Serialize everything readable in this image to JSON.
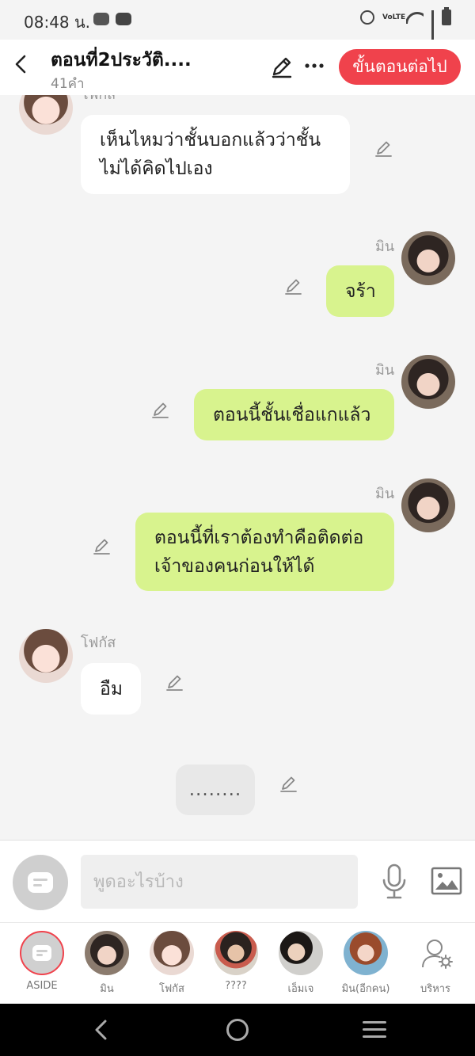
{
  "status_bar": {
    "time": "08:48 น.",
    "volte_label": "VoLTE",
    "icons": [
      "line-icon",
      "youtube-icon",
      "alarm-icon",
      "volte-icon",
      "wifi-icon",
      "signal-icon",
      "battery-icon"
    ]
  },
  "header": {
    "title": "ตอนที่2ประวัติ....",
    "word_count": "41คำ",
    "next_label": "ขั้นตอนต่อไป",
    "accent_color": "#f0424c"
  },
  "chat": {
    "messages": [
      {
        "side": "left",
        "sender": "โฟกัส",
        "lines": [
          "เห็นไหมว่าชั้นบอกแล้วว่าชั้น",
          "ไม่ได้คิดไปเอง"
        ]
      },
      {
        "side": "right",
        "sender": "มิน",
        "lines": [
          "จร้า"
        ]
      },
      {
        "side": "right",
        "sender": "มิน",
        "lines": [
          "ตอนนี้ชั้นเชื่อแกแล้ว"
        ]
      },
      {
        "side": "right",
        "sender": "มิน",
        "lines": [
          "ตอนนี้ที่เราต้องทำคือติดต่อ",
          "เจ้าของคนก่อนให้ได้"
        ]
      },
      {
        "side": "left",
        "sender": "โฟกัส",
        "lines": [
          "อืม"
        ]
      },
      {
        "side": "center",
        "sender": "",
        "lines": [
          "........"
        ]
      }
    ],
    "bubble_colors": {
      "white": "#ffffff",
      "green": "#d8f38e",
      "typing": "#e8e8e8"
    }
  },
  "input": {
    "placeholder": "พูดอะไรบ้าง"
  },
  "characters": [
    {
      "label": "ASIDE"
    },
    {
      "label": "มิน"
    },
    {
      "label": "โฟกัส"
    },
    {
      "label": "????"
    },
    {
      "label": "เอ็มเจ"
    },
    {
      "label": "มิน(อีกคน)"
    },
    {
      "label": "บริหาร"
    }
  ]
}
